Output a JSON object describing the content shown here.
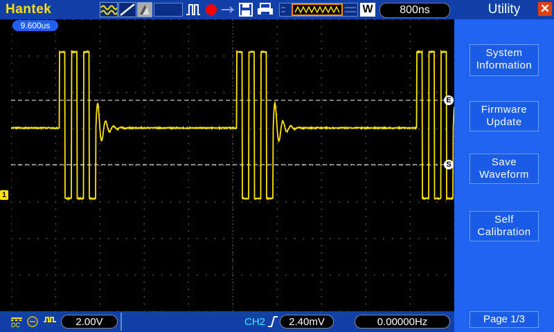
{
  "header": {
    "brand": "Hantek",
    "timebase": "800ns",
    "mode_label": "W"
  },
  "icons": {
    "acquire": "sample-wave-icon",
    "trigger_mode": "ramp-icon",
    "persist": "persist-icon",
    "pulse": "pulse-icon",
    "run": "record-icon",
    "save": "floppy-icon",
    "print": "printer-icon"
  },
  "screen": {
    "trigger_time": "9.600us",
    "marker_e": "E",
    "marker_s": "S",
    "channel_marker": "1"
  },
  "bottom": {
    "ch1_volts": "2.00V",
    "trigger_source": "CH2",
    "trigger_level": "2.40mV",
    "frequency": "0.00000Hz"
  },
  "sidebar": {
    "title": "Utility",
    "buttons": [
      {
        "label": "System\nInformation"
      },
      {
        "label": "Firmware\nUpdate"
      },
      {
        "label": "Save\nWaveform"
      },
      {
        "label": "Self\nCalibration"
      }
    ],
    "page": "Page 1/3"
  },
  "colors": {
    "trace": "#ffe500",
    "bar": "#1040a8",
    "sidebar": "#1e64f0",
    "record": "#ff0000"
  }
}
